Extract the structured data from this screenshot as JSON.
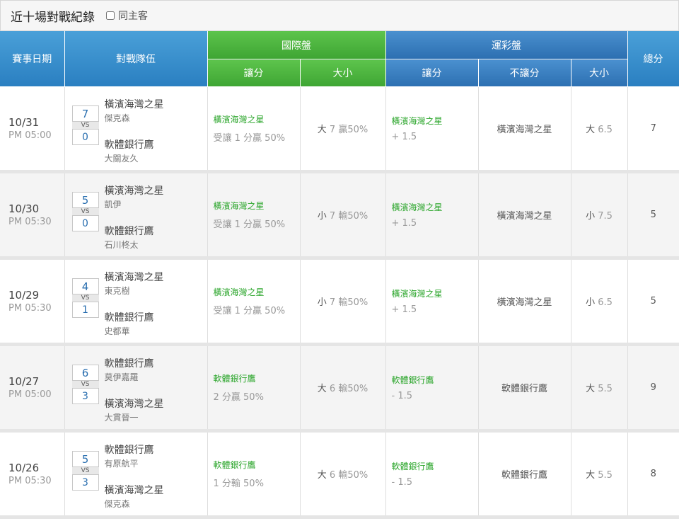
{
  "header": {
    "title": "近十場對戰紀錄",
    "checkbox_label": "同主客"
  },
  "columns": {
    "date": "賽事日期",
    "teams": "對戰隊伍",
    "intl": "國際盤",
    "lottery": "運彩盤",
    "total": "總分",
    "intl_spread": "讓分",
    "intl_ou": "大小",
    "lot_spread": "讓分",
    "lot_ml": "不讓分",
    "lot_ou": "大小"
  },
  "vs": "VS",
  "rows": [
    {
      "date": "10/31",
      "time": "PM 05:00",
      "home": "橫濱海灣之星",
      "home_pitcher": "傑克森",
      "home_score": "7",
      "away": "軟體銀行鷹",
      "away_pitcher": "大關友久",
      "away_score": "0",
      "intl_spread_team": "橫濱海灣之星",
      "intl_spread_line": "受讓 1 分贏 50%",
      "intl_ou_side": "大",
      "intl_ou_val": "7  贏50%",
      "lot_spread_team": "橫濱海灣之星",
      "lot_spread_line": "+ 1.5",
      "lot_ml": "橫濱海灣之星",
      "lot_ou_side": "大",
      "lot_ou_val": "6.5",
      "total": "7"
    },
    {
      "date": "10/30",
      "time": "PM 05:30",
      "home": "橫濱海灣之星",
      "home_pitcher": "凱伊",
      "home_score": "5",
      "away": "軟體銀行鷹",
      "away_pitcher": "石川柊太",
      "away_score": "0",
      "intl_spread_team": "橫濱海灣之星",
      "intl_spread_line": "受讓 1 分贏 50%",
      "intl_ou_side": "小",
      "intl_ou_val": "7  輸50%",
      "lot_spread_team": "橫濱海灣之星",
      "lot_spread_line": "+ 1.5",
      "lot_ml": "橫濱海灣之星",
      "lot_ou_side": "小",
      "lot_ou_val": "7.5",
      "total": "5"
    },
    {
      "date": "10/29",
      "time": "PM 05:30",
      "home": "橫濱海灣之星",
      "home_pitcher": "東克樹",
      "home_score": "4",
      "away": "軟體銀行鷹",
      "away_pitcher": "史都華",
      "away_score": "1",
      "intl_spread_team": "橫濱海灣之星",
      "intl_spread_line": "受讓 1 分贏 50%",
      "intl_ou_side": "小",
      "intl_ou_val": "7  輸50%",
      "lot_spread_team": "橫濱海灣之星",
      "lot_spread_line": "+ 1.5",
      "lot_ml": "橫濱海灣之星",
      "lot_ou_side": "小",
      "lot_ou_val": "6.5",
      "total": "5"
    },
    {
      "date": "10/27",
      "time": "PM 05:00",
      "home": "軟體銀行鷹",
      "home_pitcher": "莫伊嘉羅",
      "home_score": "6",
      "away": "橫濱海灣之星",
      "away_pitcher": "大貫晉一",
      "away_score": "3",
      "intl_spread_team": "軟體銀行鷹",
      "intl_spread_line": "2 分贏 50%",
      "intl_ou_side": "大",
      "intl_ou_val": "6  輸50%",
      "lot_spread_team": "軟體銀行鷹",
      "lot_spread_line": "- 1.5",
      "lot_ml": "軟體銀行鷹",
      "lot_ou_side": "大",
      "lot_ou_val": "5.5",
      "total": "9"
    },
    {
      "date": "10/26",
      "time": "PM 05:30",
      "home": "軟體銀行鷹",
      "home_pitcher": "有原航平",
      "home_score": "5",
      "away": "橫濱海灣之星",
      "away_pitcher": "傑克森",
      "away_score": "3",
      "intl_spread_team": "軟體銀行鷹",
      "intl_spread_line": "1 分輸 50%",
      "intl_ou_side": "大",
      "intl_ou_val": "6  輸50%",
      "lot_spread_team": "軟體銀行鷹",
      "lot_spread_line": "- 1.5",
      "lot_ml": "軟體銀行鷹",
      "lot_ou_side": "大",
      "lot_ou_val": "5.5",
      "total": "8"
    }
  ]
}
